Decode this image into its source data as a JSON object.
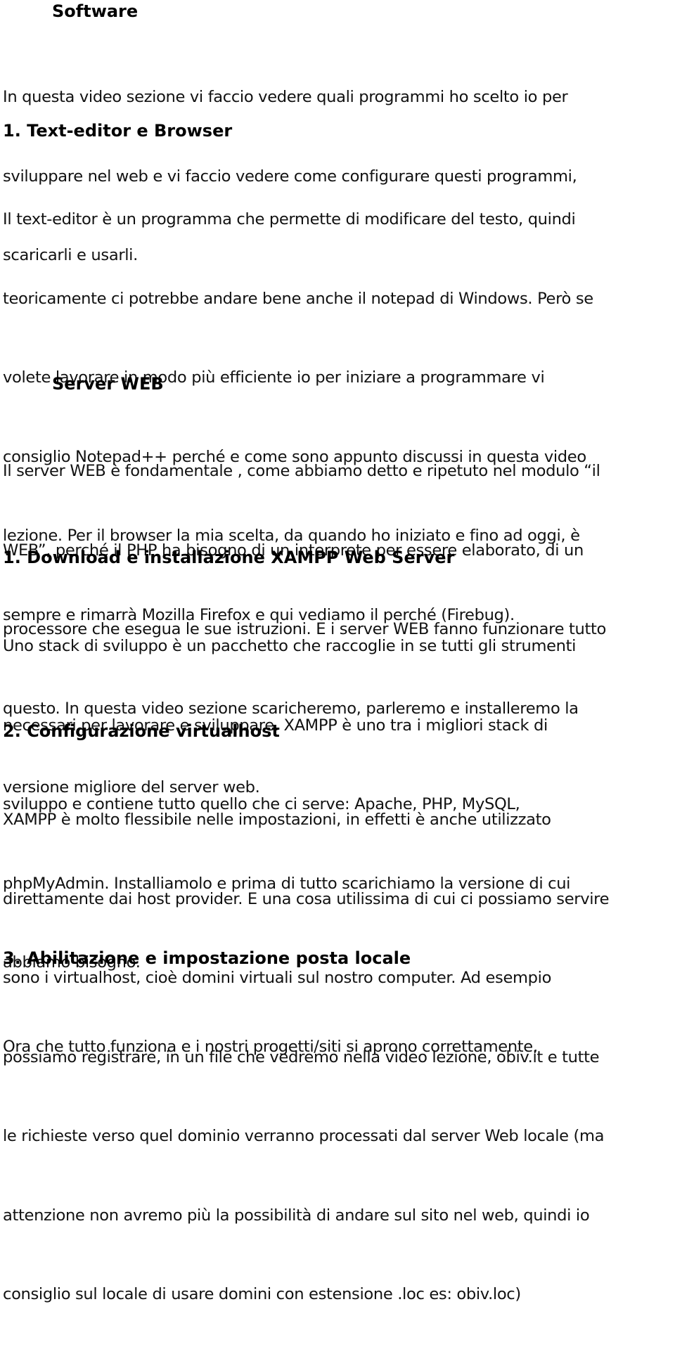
{
  "document": {
    "sections": [
      {
        "title": "Software",
        "intro_lines": [
          "In questa video sezione vi faccio vedere quali programmi ho scelto io per",
          "sviluppare nel web e vi faccio vedere come configurare questi programmi,",
          "scaricarli e usarli."
        ],
        "subsections": [
          {
            "heading": "1. Text-editor e Browser",
            "lines": [
              "Il text-editor è un programma che permette di modificare del testo, quindi",
              "teoricamente ci potrebbe andare bene anche il notepad di Windows. Però se",
              "volete lavorare in modo più efficiente io per iniziare a programmare vi",
              "consiglio Notepad++ perché e come sono appunto discussi in questa video",
              "lezione. Per il browser la mia scelta, da quando ho iniziato e fino ad oggi, è",
              "sempre e rimarrà Mozilla Firefox e qui vediamo il perché (Firebug)."
            ]
          }
        ]
      },
      {
        "title": "Server WEB",
        "intro_lines": [
          "Il server WEB è fondamentale , come abbiamo detto e ripetuto nel modulo “il",
          "WEB”, perché il PHP ha bisogno di un interprete per essere elaborato, di un",
          "processore che esegua le sue istruzioni. E i server WEB fanno funzionare tutto",
          "questo. In questa video sezione scaricheremo, parleremo e installeremo la",
          "versione migliore del server web."
        ],
        "subsections": [
          {
            "heading": "1. Download e installazione XAMPP Web Server",
            "lines": [
              "Uno stack di sviluppo è un pacchetto che raccoglie in se tutti gli strumenti",
              "necessari per lavorare e sviluppare. XAMPP è uno tra i migliori stack di",
              "sviluppo e contiene tutto quello che ci serve: Apache, PHP, MySQL,",
              "phpMyAdmin. Installiamolo e prima di tutto scarichiamo la versione di cui",
              "abbiamo bisogno."
            ]
          },
          {
            "heading": "2. Configurazione virtualhost",
            "lines": [
              "XAMPP è molto flessibile nelle impostazioni, in effetti è anche utilizzato",
              "direttamente dai host provider. E una cosa utilissima di cui ci possiamo servire",
              "sono i virtualhost, cioè domini virtuali sul nostro computer. Ad esempio",
              "possiamo registrare, in un file che vedremo nella video lezione, obiv.it e tutte",
              "le richieste verso quel dominio verranno processati dal server Web locale (ma",
              "attenzione non avremo più la possibilità di andare sul sito nel web, quindi io",
              "consiglio sul locale di usare domini con estensione .loc es: obiv.loc)"
            ]
          },
          {
            "heading": "3. Abilitazione e impostazione posta locale",
            "lines": [
              "Ora che tutto funziona e i nostri progetti/siti si aprono correttamente,"
            ]
          }
        ]
      }
    ]
  }
}
